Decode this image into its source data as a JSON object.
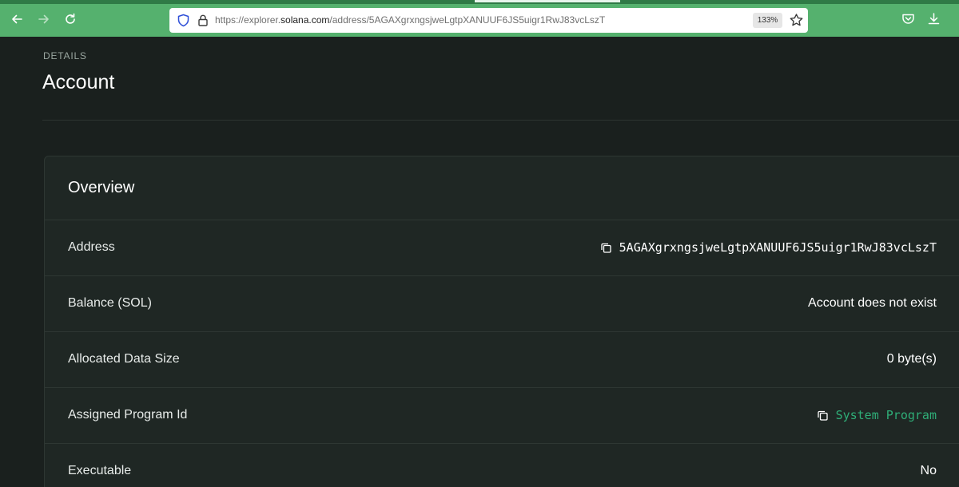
{
  "browser": {
    "url_prefix": "https://explorer.",
    "url_host": "solana.com",
    "url_path": "/address/5AGAXgrxngsjweLgtpXANUUF6JS5uigr1RwJ83vcLszT",
    "zoom": "133%"
  },
  "page": {
    "pretitle": "DETAILS",
    "title": "Account"
  },
  "overview": {
    "title": "Overview",
    "rows": [
      {
        "label": "Address",
        "value": "5AGAXgrxngsjweLgtpXANUUF6JS5uigr1RwJ83vcLszT"
      },
      {
        "label": "Balance (SOL)",
        "value": "Account does not exist"
      },
      {
        "label": "Allocated Data Size",
        "value": "0 byte(s)"
      },
      {
        "label": "Assigned Program Id",
        "value": "System Program"
      },
      {
        "label": "Executable",
        "value": "No"
      }
    ]
  },
  "colors": {
    "toolbar": "#55b16e",
    "page_bg": "#1a201e",
    "card_bg": "#1f2724",
    "link": "#2fae78"
  }
}
